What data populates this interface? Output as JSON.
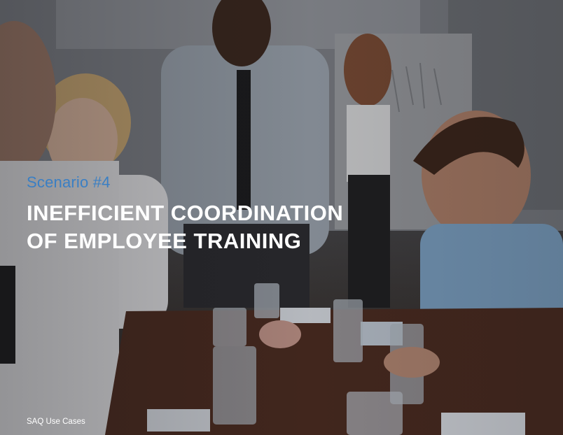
{
  "slide": {
    "scenario_label": "Scenario #4",
    "title_lines": [
      "INEFFICIENT COORDINATION",
      "OF EMPLOYEE TRAINING"
    ],
    "footer_text": "SAQ Use Cases"
  },
  "colors": {
    "scenario_accent": "#3a7fc4",
    "title_text": "#ffffff",
    "footer_text": "#ffffff"
  }
}
